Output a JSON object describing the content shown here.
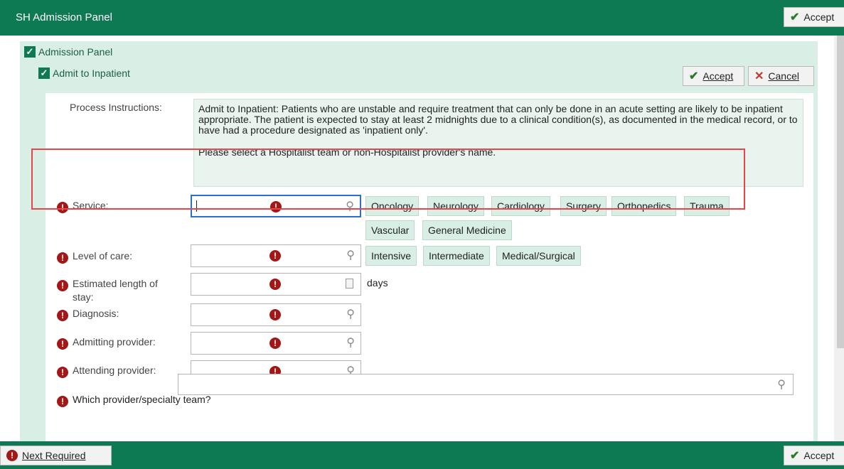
{
  "window": {
    "title": "SH Admission Panel"
  },
  "top_bar": {
    "accept_label": "Accept"
  },
  "panel": {
    "header": "Admission Panel",
    "sub_header": "Admit to Inpatient",
    "accept_label": "Accept",
    "cancel_label": "Cancel"
  },
  "process_instructions": {
    "label": "Process Instructions:",
    "paragraph1": "Admit to Inpatient:  Patients who are unstable and require treatment that can only be done in an acute setting are likely to be inpatient appropriate. The patient is expected to stay at least 2 midnights due to a clinical condition(s), as documented in the medical record, or to have had a procedure designated as 'inpatient only'.",
    "paragraph2": "Please select a Hospitalist team or non-Hospitalist provider's name."
  },
  "fields": {
    "service": {
      "label": "Service:",
      "value": "",
      "options": [
        "Oncology",
        "Neurology",
        "Cardiology",
        "Surgery",
        "Orthopedics",
        "Trauma",
        "Vascular",
        "General Medicine"
      ]
    },
    "level_of_care": {
      "label": "Level of care:",
      "value": "",
      "options": [
        "Intensive",
        "Intermediate",
        "Medical/Surgical"
      ]
    },
    "length_of_stay": {
      "label_line1": "Estimated length of",
      "label_line2": "stay:",
      "value": "",
      "unit": "days"
    },
    "diagnosis": {
      "label": "Diagnosis:",
      "value": ""
    },
    "admitting_provider": {
      "label": "Admitting provider:",
      "value": ""
    },
    "attending_provider": {
      "label": "Attending provider:",
      "value": ""
    },
    "provider_team": {
      "label": "Which provider/specialty team?",
      "value": ""
    }
  },
  "bottom_bar": {
    "next_required_label": "Next Required",
    "accept_label": "Accept"
  },
  "colors": {
    "titlebar": "#0e7a54",
    "panel_bg": "#d9efe6",
    "required": "#a31717",
    "highlight": "#e8454a"
  }
}
